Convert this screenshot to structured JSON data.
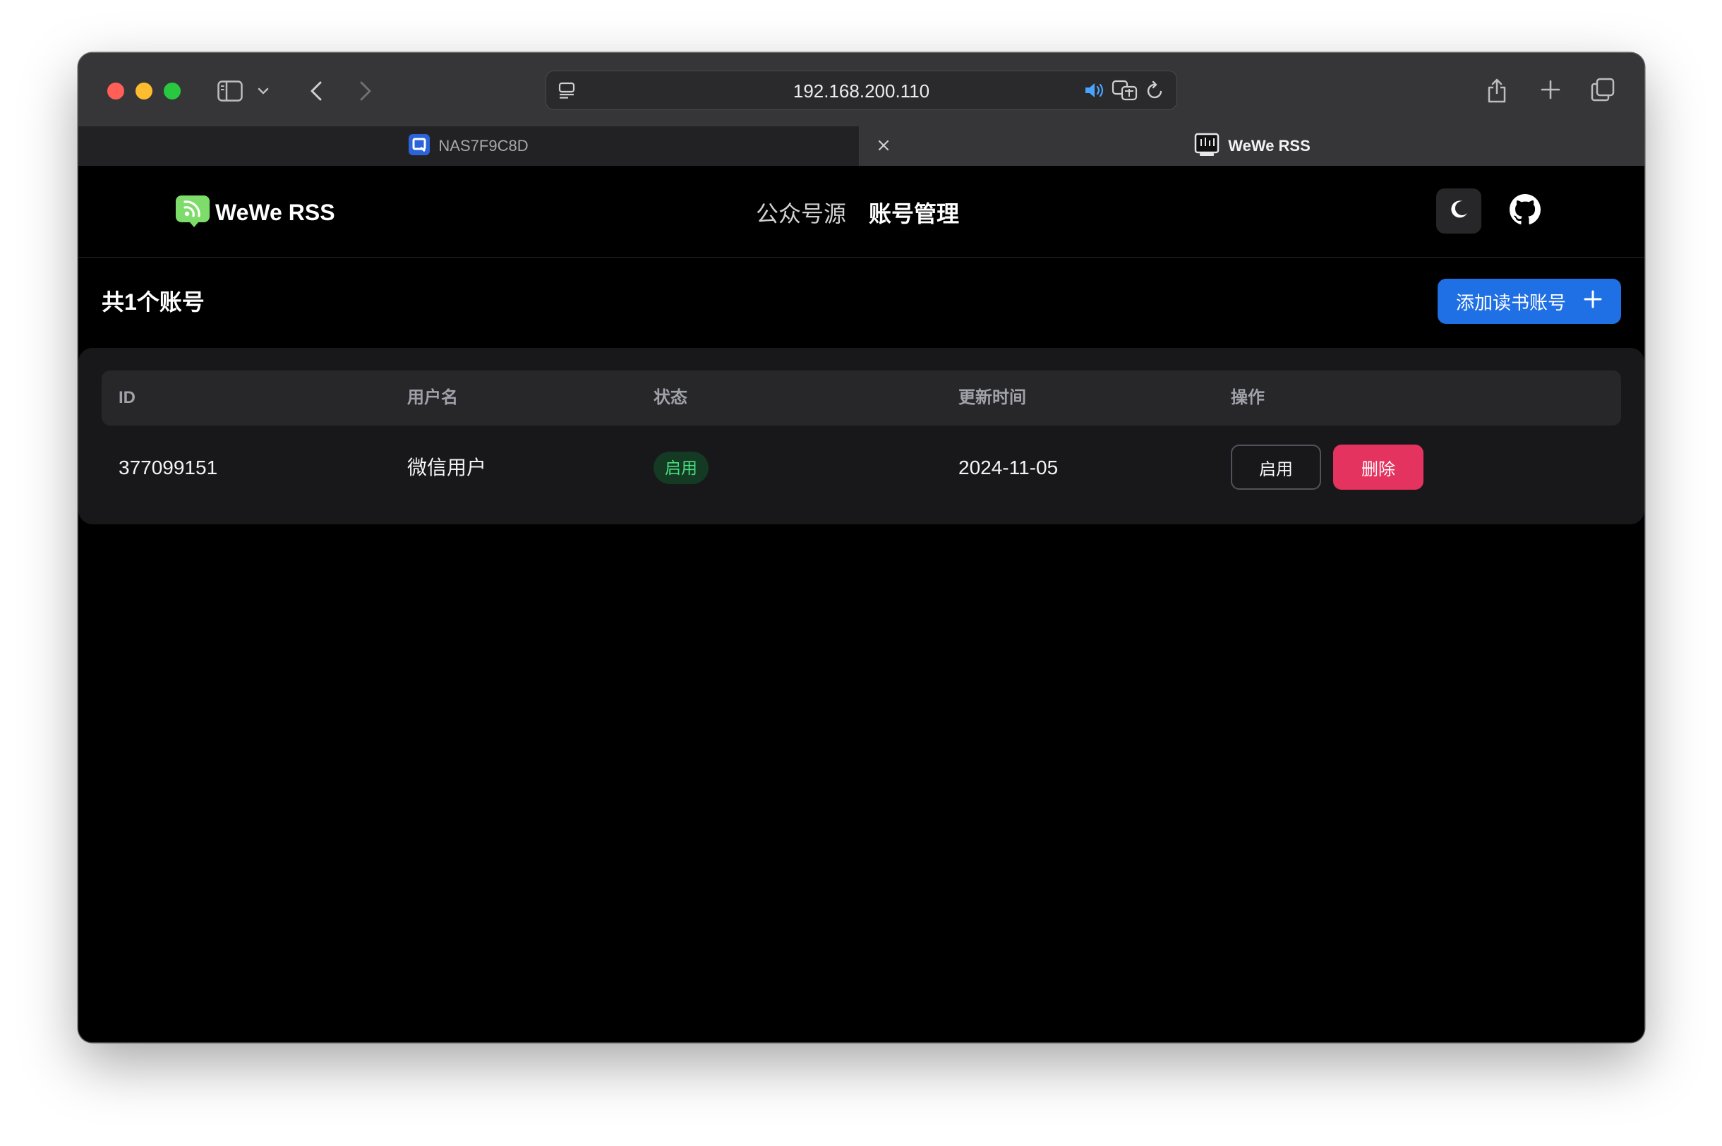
{
  "browser": {
    "address": "192.168.200.110",
    "tabs": [
      {
        "label": "NAS7F9C8D",
        "active": false
      },
      {
        "label": "WeWe RSS",
        "active": true
      }
    ]
  },
  "app": {
    "brand": "WeWe RSS",
    "nav": [
      {
        "label": "公众号源",
        "active": false
      },
      {
        "label": "账号管理",
        "active": true
      }
    ]
  },
  "content": {
    "count_title": "共1个账号",
    "add_button": "添加读书账号",
    "table": {
      "columns": [
        "ID",
        "用户名",
        "状态",
        "更新时间",
        "操作"
      ],
      "rows": [
        {
          "id": "377099151",
          "username": "微信用户",
          "status": "启用",
          "updated": "2024-11-05",
          "actions": {
            "enable": "启用",
            "delete": "删除"
          }
        }
      ]
    }
  },
  "colors": {
    "accent_blue": "#1f6fe5",
    "danger": "#e4335f",
    "status_green": "#4ade80"
  }
}
